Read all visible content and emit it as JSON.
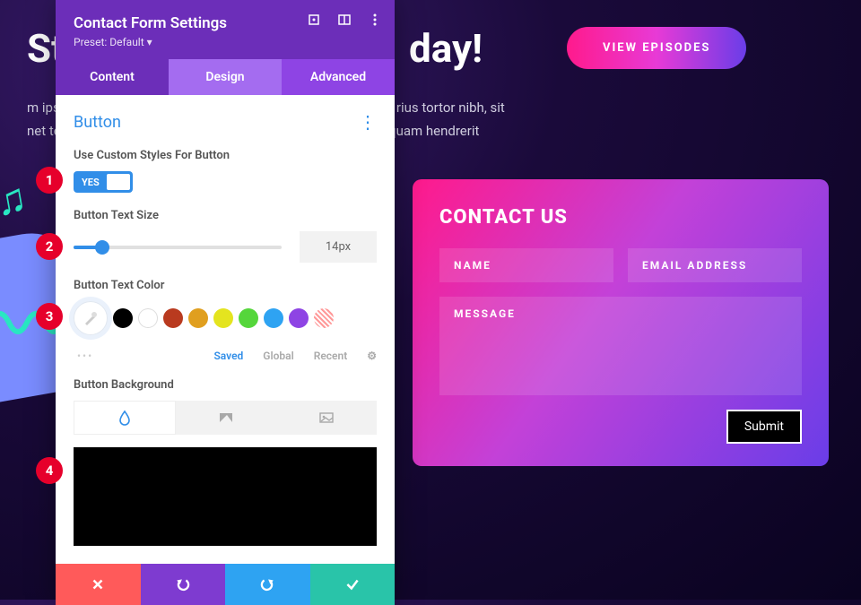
{
  "background": {
    "heading_part1": "St",
    "heading_part2": "day!",
    "para_left": "m ipsum",
    "para_mid": "rius tortor nibh, sit",
    "para_left2": "net temp",
    "para_mid2": "quam hendrerit",
    "view_episodes": "VIEW EPISODES"
  },
  "contact": {
    "title": "CONTACT US",
    "name": "NAME",
    "email": "EMAIL ADDRESS",
    "message": "MESSAGE",
    "submit": "Submit"
  },
  "panel": {
    "title": "Contact Form Settings",
    "preset": "Preset: Default ▾",
    "tabs": {
      "content": "Content",
      "design": "Design",
      "advanced": "Advanced"
    },
    "section": "Button",
    "custom_styles_label": "Use Custom Styles For Button",
    "toggle_yes": "YES",
    "text_size_label": "Button Text Size",
    "text_size_value": "14px",
    "text_color_label": "Button Text Color",
    "subtabs": {
      "saved": "Saved",
      "global": "Global",
      "recent": "Recent"
    },
    "bg_label": "Button Background"
  },
  "swatches": [
    "#000000",
    "#ffffff",
    "#b93a1f",
    "#e09f1f",
    "#e4e41f",
    "#55d63b",
    "#2ea3f2",
    "#8e44e4",
    "transparent"
  ],
  "badges": [
    "1",
    "2",
    "3",
    "4"
  ]
}
